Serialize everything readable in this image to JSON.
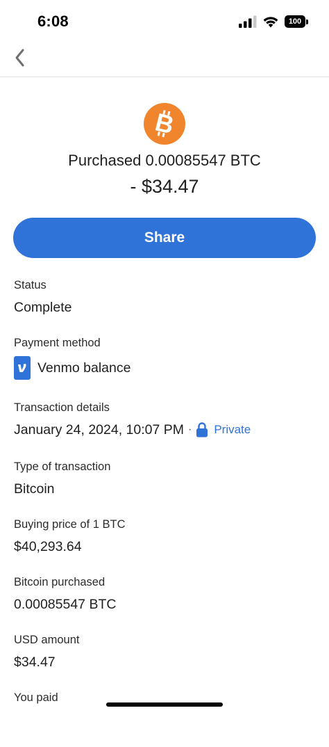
{
  "status_bar": {
    "time": "6:08",
    "battery_level": "100",
    "icons": [
      "signal-icon",
      "wifi-icon",
      "battery-icon"
    ]
  },
  "nav": {
    "back_icon": "chevron-left-icon"
  },
  "hero": {
    "logo_icon": "bitcoin-icon",
    "title": "Purchased 0.00085547 BTC",
    "amount": "- $34.47"
  },
  "share_label": "Share",
  "details": {
    "status": {
      "label": "Status",
      "value": "Complete"
    },
    "payment_method": {
      "label": "Payment method",
      "value": "Venmo balance",
      "icon": "venmo-icon"
    },
    "transaction_details": {
      "label": "Transaction details",
      "date": "January 24, 2024, 10:07 PM",
      "separator": "·",
      "privacy": "Private",
      "privacy_icon": "lock-icon"
    },
    "type": {
      "label": "Type of transaction",
      "value": "Bitcoin"
    },
    "buying_price": {
      "label": "Buying price of 1 BTC",
      "value": "$40,293.64"
    },
    "bitcoin_purchased": {
      "label": "Bitcoin purchased",
      "value": "0.00085547 BTC"
    },
    "usd_amount": {
      "label": "USD amount",
      "value": "$34.47"
    },
    "you_paid": {
      "label": "You paid"
    }
  },
  "colors": {
    "accent_blue": "#2f73d9",
    "bitcoin_orange": "#f0852d",
    "text": "#1f1f1f",
    "divider": "#e2e2e2"
  }
}
